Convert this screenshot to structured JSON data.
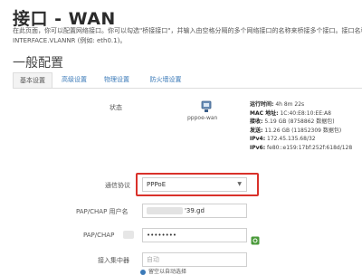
{
  "page": {
    "title": "接口 - WAN",
    "description_line1": "在此页面，你可以配置网络接口。你可以勾选\"桥接接口\"，并输入由空格分隔的多个网络接口的名称来桥接多个接口。接口名称中可以使用",
    "description_line2": "INTERFACE.VLANNR (例如: eth0.1)。"
  },
  "section_title": "一般配置",
  "tabs": [
    {
      "label": "基本设置",
      "active": true
    },
    {
      "label": "高级设置",
      "active": false
    },
    {
      "label": "物理设置",
      "active": false
    },
    {
      "label": "防火墙设置",
      "active": false
    }
  ],
  "status": {
    "label": "状态",
    "device_name": "pppoe-wan",
    "device_icon": "network-device-icon",
    "rows": [
      {
        "key": "运行时间:",
        "value": "4h 8m 22s"
      },
      {
        "key": "MAC 地址:",
        "value": "1C:40:E8:10:EE:A8"
      },
      {
        "key": "接收:",
        "value": "5.19 GB (8758862 数据包)"
      },
      {
        "key": "发送:",
        "value": "11.26 GB (11852309 数据包)"
      },
      {
        "key": "IPv4:",
        "value": "172.45.135.68/32"
      },
      {
        "key": "IPv6:",
        "value": "fe80::e159:17bf:252f:618d/128"
      }
    ]
  },
  "form": {
    "protocol": {
      "label": "通信协议",
      "value": "PPPoE"
    },
    "username": {
      "label": "PAP/CHAP 用户名",
      "value": "'39.gd"
    },
    "password": {
      "label": "PAP/CHAP",
      "value": "••••••••"
    },
    "concentrator": {
      "label": "接入集中器",
      "placeholder": "自动"
    },
    "hint": "留空以自动选择"
  },
  "colors": {
    "accent": "#3b7ab8",
    "highlight": "#d9312a",
    "reveal_icon": "#4a9a3a"
  }
}
